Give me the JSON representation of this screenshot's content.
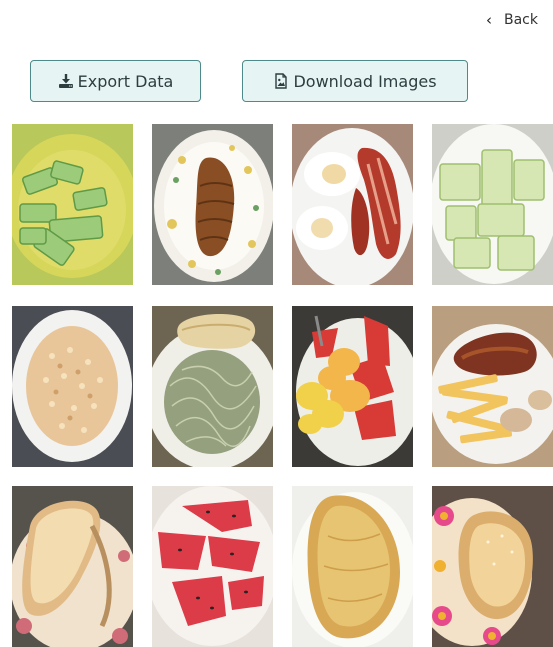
{
  "header": {
    "back_label": "Back"
  },
  "toolbar": {
    "export_label": "Export Data",
    "download_label": "Download Images"
  },
  "colors": {
    "button_bg": "#e7f4f4",
    "button_border": "#4f8a8a",
    "button_text": "#2d3e40"
  },
  "gallery": {
    "images": [
      {
        "subject": "cucumber slices on yellow plate"
      },
      {
        "subject": "bread roll on white plate"
      },
      {
        "subject": "fried eggs with bacon"
      },
      {
        "subject": "cucumber pieces on white plate"
      },
      {
        "subject": "corn kernels on white plate"
      },
      {
        "subject": "noodles with bread"
      },
      {
        "subject": "fruit salad with apple and watermelon"
      },
      {
        "subject": "fried chicken with fries"
      },
      {
        "subject": "sandwich bread on patterned plate"
      },
      {
        "subject": "watermelon slices"
      },
      {
        "subject": "omelette"
      },
      {
        "subject": "bread roll on flowered plate"
      }
    ]
  }
}
